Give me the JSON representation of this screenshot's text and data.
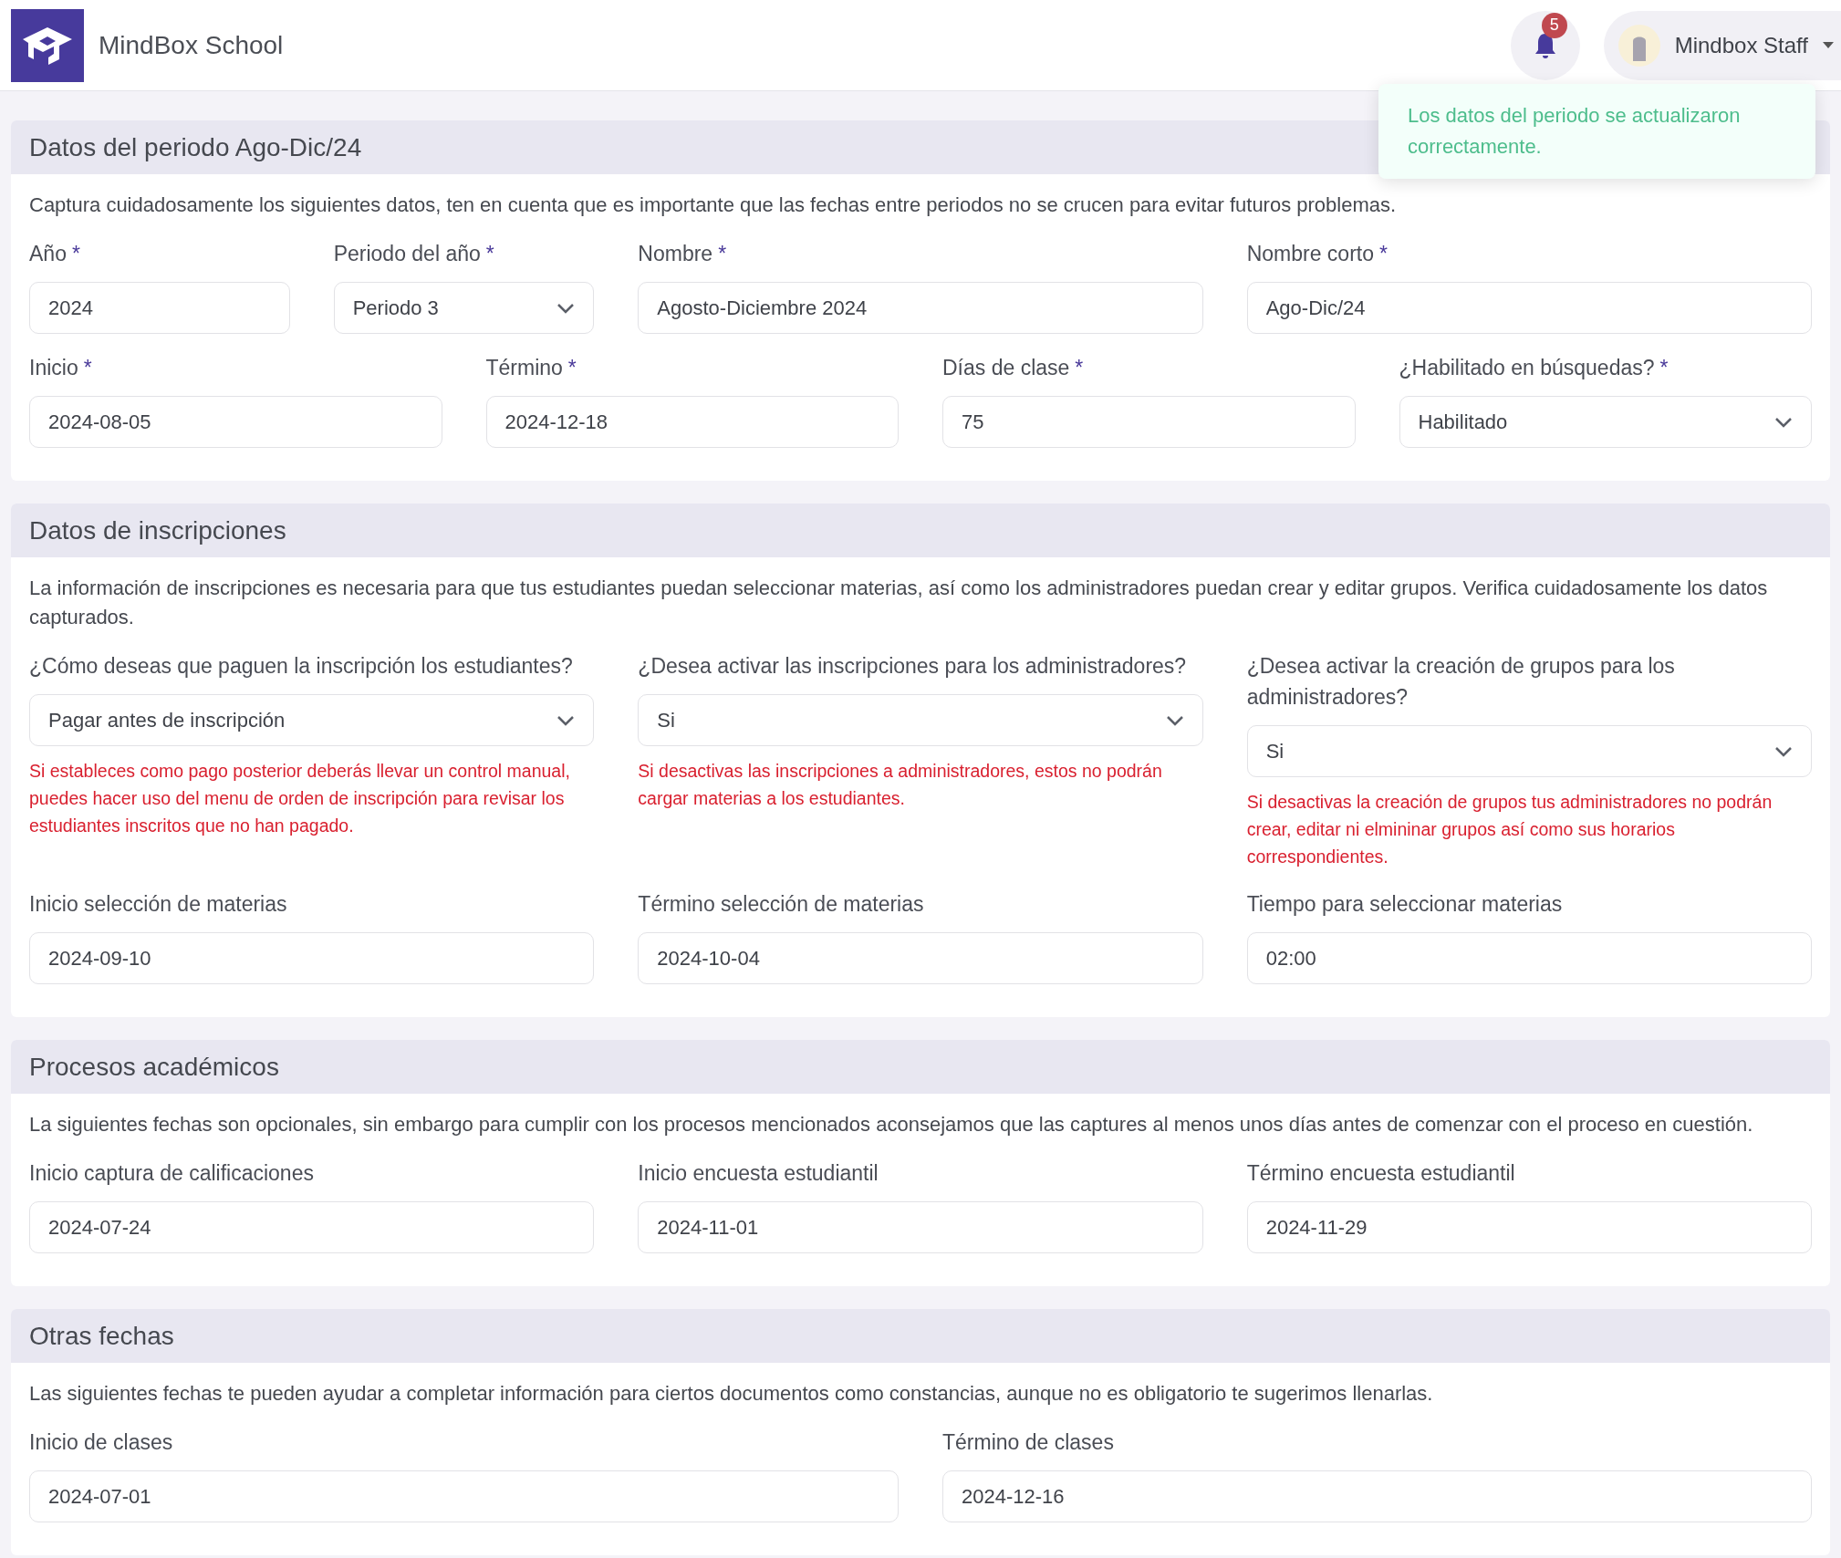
{
  "header": {
    "brand": "MindBox School",
    "notifications": {
      "count": "5"
    },
    "user": {
      "name": "Mindbox Staff"
    }
  },
  "toast": {
    "message": "Los datos del periodo se actualizaron correctamente."
  },
  "sections": [
    {
      "title": "Datos del periodo Ago-Dic/24",
      "description": "Captura cuidadosamente los siguientes datos, ten en cuenta que es importante que las fechas entre periodos no se crucen para evitar futuros problemas.",
      "rows": [
        {
          "fields": [
            {
              "label": "Año",
              "required_mark": "*",
              "kind": "input",
              "value": "2024"
            },
            {
              "label": "Periodo del año",
              "required_mark": "*",
              "kind": "select",
              "value": "Periodo 3"
            },
            {
              "label": "Nombre",
              "required_mark": "*",
              "kind": "input",
              "value": "Agosto-Diciembre 2024"
            },
            {
              "label": "Nombre corto",
              "required_mark": "*",
              "kind": "input",
              "value": "Ago-Dic/24"
            }
          ]
        },
        {
          "fields": [
            {
              "label": "Inicio",
              "required_mark": "*",
              "kind": "input",
              "value": "2024-08-05"
            },
            {
              "label": "Término",
              "required_mark": "*",
              "kind": "input",
              "value": "2024-12-18"
            },
            {
              "label": "Días de clase",
              "required_mark": "*",
              "kind": "input",
              "value": "75"
            },
            {
              "label": "¿Habilitado en búsquedas?",
              "required_mark": "*",
              "kind": "select",
              "value": "Habilitado"
            }
          ]
        }
      ]
    },
    {
      "title": "Datos de inscripciones",
      "description": "La información de inscripciones es necesaria para que tus estudiantes puedan seleccionar materias, así como los administradores puedan crear y editar grupos. Verifica cuidadosamente los datos capturados.",
      "rows": [
        {
          "fields": [
            {
              "label": "¿Cómo deseas que paguen la inscripción los estudiantes?",
              "kind": "select",
              "value": "Pagar antes de inscripción",
              "help": "Si estableces como pago posterior deberás llevar un control manual, puedes hacer uso del menu de orden de inscripción para revisar los estudiantes inscritos que no han pagado."
            },
            {
              "label": "¿Desea activar las inscripciones para los administradores?",
              "kind": "select",
              "value": "Si",
              "help": "Si desactivas las inscripciones a administradores, estos no podrán cargar materias a los estudiantes."
            },
            {
              "label": "¿Desea activar la creación de grupos para los administradores?",
              "kind": "select",
              "value": "Si",
              "help": "Si desactivas la creación de grupos tus administradores no podrán crear, editar ni elmininar grupos así como sus horarios correspondientes."
            }
          ]
        },
        {
          "fields": [
            {
              "label": "Inicio selección de materias",
              "kind": "input",
              "value": "2024-09-10"
            },
            {
              "label": "Término selección de materias",
              "kind": "input",
              "value": "2024-10-04"
            },
            {
              "label": "Tiempo para seleccionar materias",
              "kind": "input",
              "value": "02:00"
            }
          ]
        }
      ]
    },
    {
      "title": "Procesos académicos",
      "description": "La siguientes fechas son opcionales, sin embargo para cumplir con los procesos mencionados aconsejamos que las captures al menos unos días antes de comenzar con el proceso en cuestión.",
      "rows": [
        {
          "fields": [
            {
              "label": "Inicio captura de calificaciones",
              "kind": "input",
              "value": "2024-07-24"
            },
            {
              "label": "Inicio encuesta estudiantil",
              "kind": "input",
              "value": "2024-11-01"
            },
            {
              "label": "Término encuesta estudiantil",
              "kind": "input",
              "value": "2024-11-29"
            }
          ]
        }
      ]
    },
    {
      "title": "Otras fechas",
      "description": "Las siguientes fechas te pueden ayudar a completar información para ciertos documentos como constancias, aunque no es obligatorio te sugerimos llenarlas.",
      "rows": [
        {
          "fields": [
            {
              "label": "Inicio de clases",
              "kind": "input",
              "value": "2024-07-01"
            },
            {
              "label": "Término de clases",
              "kind": "input",
              "value": "2024-12-16"
            }
          ]
        }
      ]
    }
  ]
}
